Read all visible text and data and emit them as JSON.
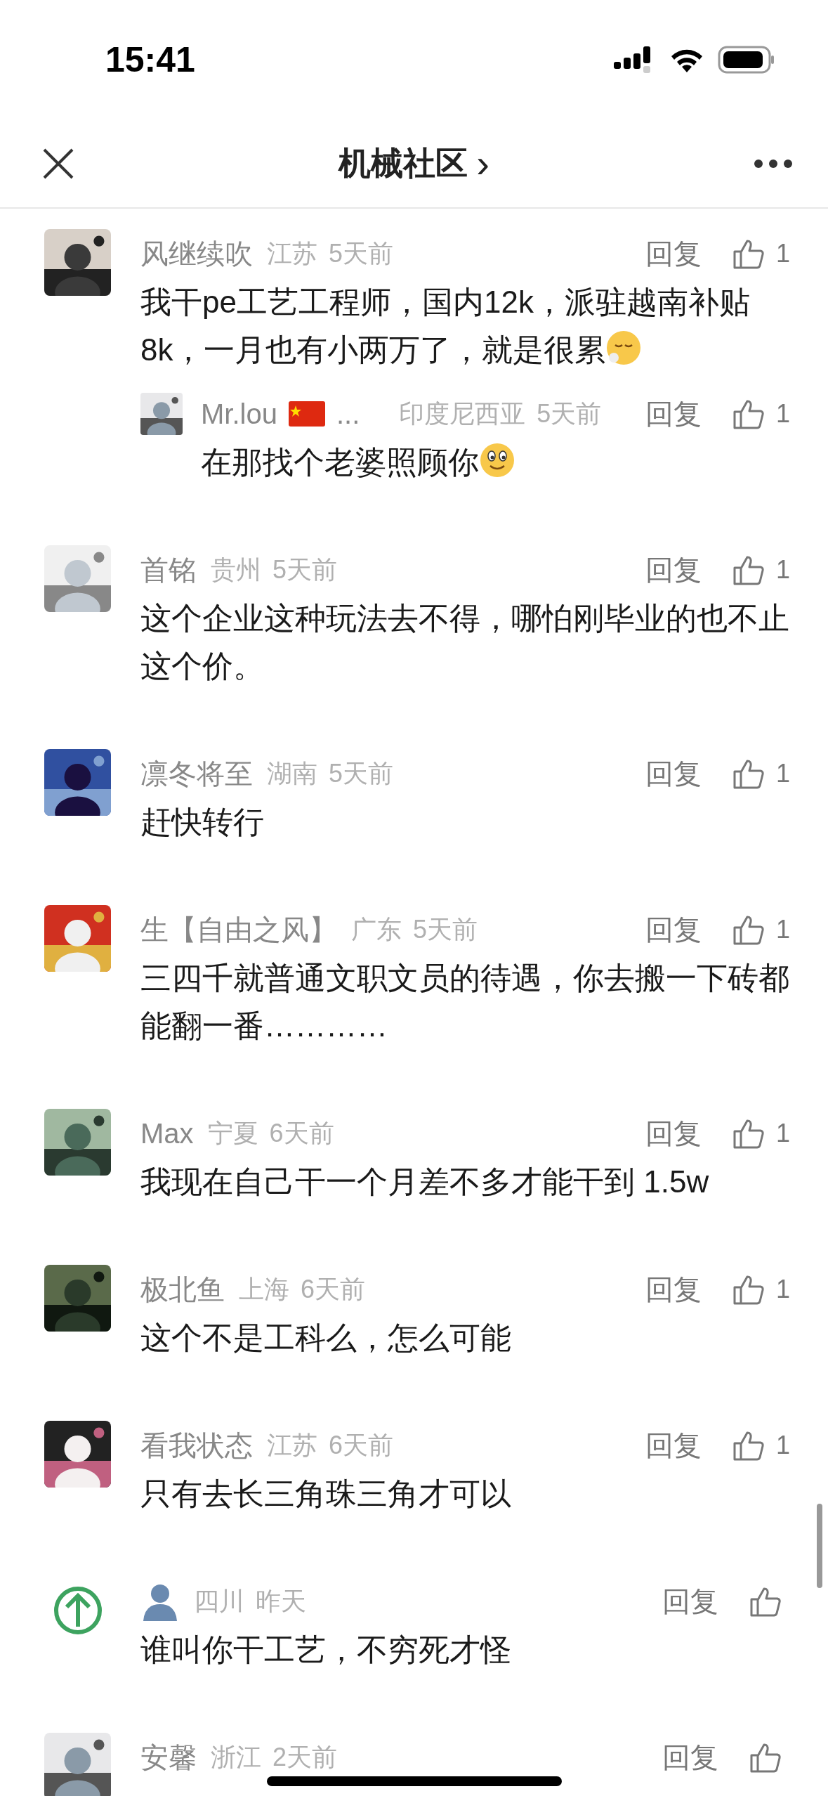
{
  "status_bar": {
    "time": "15:41"
  },
  "nav": {
    "title": "机械社区",
    "chevron": "›"
  },
  "comments": [
    {
      "name": "风继续吹",
      "region": "江苏",
      "time": "5天前",
      "text": "我干pe工艺工程师，国内12k，派驻越南补贴8k，一月也有小两万了，就是很累",
      "emoji": {
        "kind": "sigh"
      },
      "reply": "回复",
      "likes": "1",
      "replies": [
        {
          "name": "Mr.lou",
          "flag": true,
          "ellipsis": "...",
          "region": "印度尼西亚",
          "time": "5天前",
          "text": "在那找个老婆照顾你",
          "emoji": {
            "kind": "smile"
          },
          "reply": "回复",
          "likes": "1"
        }
      ]
    },
    {
      "name": "首铭",
      "region": "贵州",
      "time": "5天前",
      "text": "这个企业这种玩法去不得，哪怕刚毕业的也不止这个价。",
      "reply": "回复",
      "likes": "1"
    },
    {
      "name": "凛冬将至",
      "region": "湖南",
      "time": "5天前",
      "text": "赶快转行",
      "reply": "回复",
      "likes": "1"
    },
    {
      "name": "生【自由之风】",
      "region": "广东",
      "time": "5天前",
      "text": "三四千就普通文职文员的待遇，你去搬一下砖都能翻一番…………",
      "reply": "回复",
      "likes": "1"
    },
    {
      "name": "Max",
      "region": "宁夏",
      "time": "6天前",
      "text": "我现在自己干一个月差不多才能干到 1.5w",
      "reply": "回复",
      "likes": "1"
    },
    {
      "name": "极北鱼",
      "region": "上海",
      "time": "6天前",
      "text": "这个不是工科么，怎么可能",
      "reply": "回复",
      "likes": "1"
    },
    {
      "name": "看我状态",
      "region": "江苏",
      "time": "6天前",
      "text": "只有去长三角珠三角才可以",
      "reply": "回复",
      "likes": "1"
    },
    {
      "avatar": {
        "kind": "arrow"
      },
      "region": "四川",
      "time": "昨天",
      "text": "谁叫你干工艺，不穷死才怪",
      "reply": "回复"
    },
    {
      "name": "安馨",
      "region": "浙江",
      "time": "2天前",
      "reply": "回复"
    }
  ]
}
